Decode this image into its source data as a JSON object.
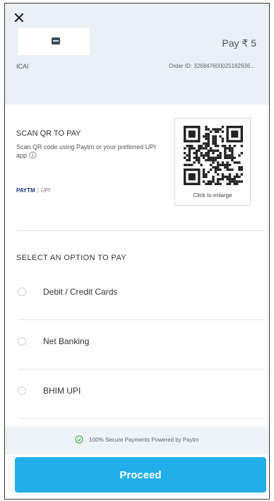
{
  "header": {
    "close_icon": "close-icon",
    "logo_icon": "card-icon",
    "pay_amount": "Pay ₹ 5",
    "merchant": "ICAI",
    "order_id": "Order ID: 326847600025162936..."
  },
  "scan": {
    "title": "SCAN QR TO PAY",
    "description": "Scan QR code using Paytm or your preferred UPI app",
    "info_icon": "info-icon",
    "brand_paytm": "PAYTM",
    "brand_sep": "|",
    "brand_upi": "UPI",
    "qr_icon": "qr-code",
    "qr_caption": "Click to enlarge"
  },
  "options": {
    "title": "SELECT AN OPTION TO PAY",
    "items": [
      {
        "label": "Debit / Credit Cards"
      },
      {
        "label": "Net Banking"
      },
      {
        "label": "BHIM UPI"
      }
    ]
  },
  "footer": {
    "secure_icon": "shield-check-icon",
    "secure_text": "100% Secure Payments Powered by Paytm",
    "proceed_label": "Proceed"
  },
  "colors": {
    "header_bg": "#eaf0f6",
    "accent": "#22aee8",
    "secure_green": "#4caf50"
  }
}
